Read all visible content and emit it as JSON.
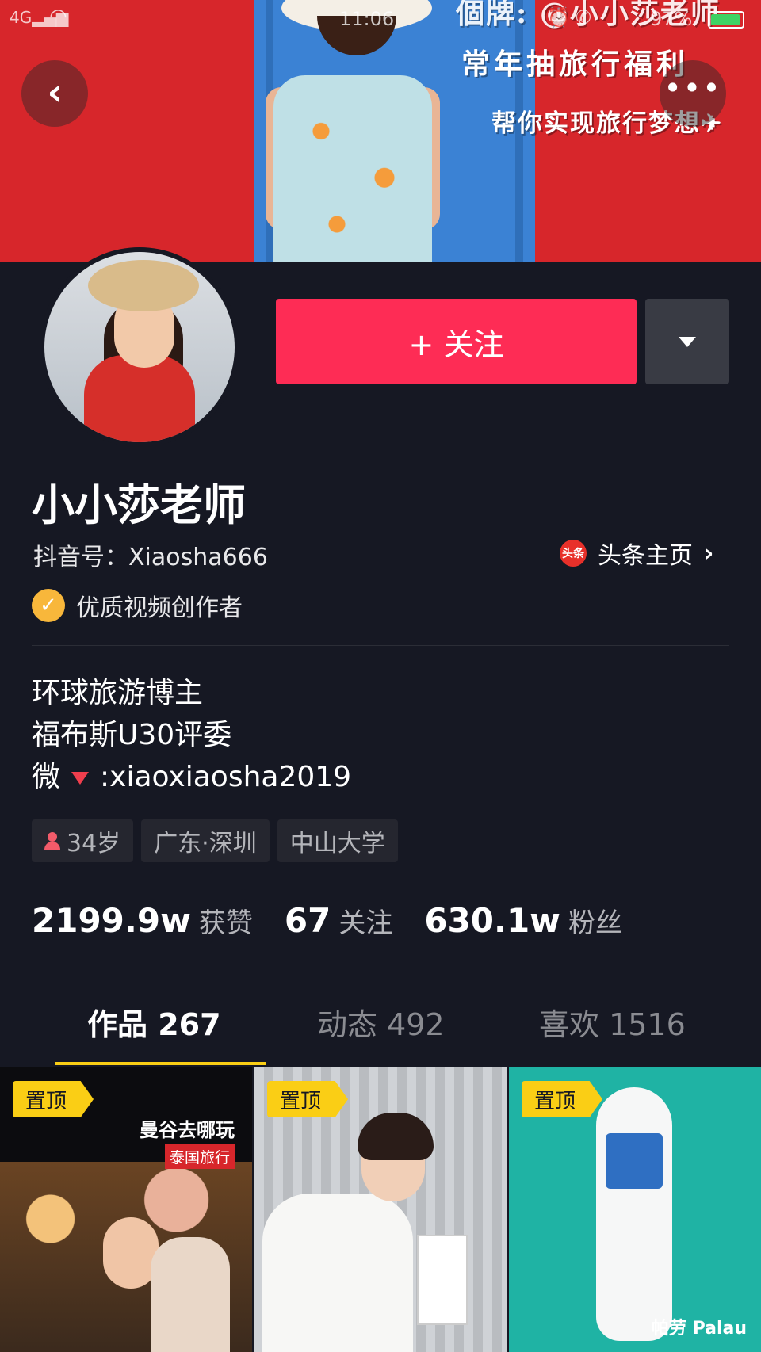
{
  "status_bar": {
    "network": "4G",
    "time": "11:06",
    "battery": "97%"
  },
  "banner": {
    "line1": "個牌: @小小莎老师",
    "line2": "常年抽旅行福利",
    "line3": "帮你实现旅行梦想✈"
  },
  "header": {
    "back_icon": "chevron-left-icon",
    "more_icon": "more-dots-icon"
  },
  "profile": {
    "follow_label": "+ 关注",
    "nickname": "小小莎老师",
    "douyin_id": "抖音号：Xiaosha666",
    "toutiao_badge": "头条",
    "toutiao_label": "头条主页",
    "verified_label": "优质视频创作者",
    "bio": [
      "环球旅游博主",
      "福布斯U30评委",
      "微",
      ":xiaoxiaosha2019"
    ],
    "tags": [
      "34岁",
      "广东·深圳",
      "中山大学"
    ],
    "stats": [
      {
        "value": "2199.9w",
        "label": "获赞"
      },
      {
        "value": "67",
        "label": "关注"
      },
      {
        "value": "630.1w",
        "label": "粉丝"
      }
    ]
  },
  "tabs": [
    {
      "label": "作品 267",
      "active": true
    },
    {
      "label": "动态 492",
      "active": false
    },
    {
      "label": "喜欢 1516",
      "active": false
    }
  ],
  "videos": [
    {
      "pin": "置顶",
      "title": "曼谷去哪玩",
      "subtitle": "泰国旅行"
    },
    {
      "pin": "置顶"
    },
    {
      "pin": "置顶",
      "caption": "帕劳 Palau"
    }
  ],
  "colors": {
    "accent": "#fe2c55",
    "background": "#161823",
    "tab_indicator": "#face15"
  }
}
